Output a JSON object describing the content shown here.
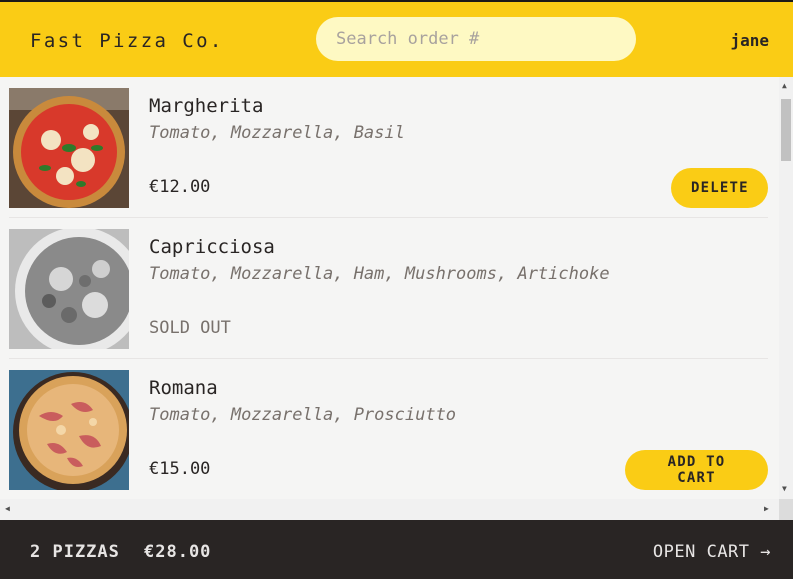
{
  "header": {
    "brand": "Fast Pizza Co.",
    "search_placeholder": "Search order #",
    "username": "jane"
  },
  "menu": [
    {
      "name": "Margherita",
      "ingredients": "Tomato, Mozzarella, Basil",
      "price": "€12.00",
      "action_label": "DELETE",
      "sold_out": false,
      "image_icon": "pizza-margherita-photo"
    },
    {
      "name": "Capricciosa",
      "ingredients": "Tomato, Mozzarella, Ham, Mushrooms, Artichoke",
      "status": "SOLD OUT",
      "sold_out": true,
      "image_icon": "pizza-capricciosa-photo-grayscale"
    },
    {
      "name": "Romana",
      "ingredients": "Tomato, Mozzarella, Prosciutto",
      "price": "€15.00",
      "action_label": "ADD TO CART",
      "sold_out": false,
      "image_icon": "pizza-romana-photo"
    }
  ],
  "cart": {
    "count_label": "2 PIZZAS",
    "total": "€28.00",
    "open_label": "OPEN CART →"
  },
  "colors": {
    "accent": "#facc15",
    "dark": "#292524",
    "background": "#f5f5f4"
  }
}
